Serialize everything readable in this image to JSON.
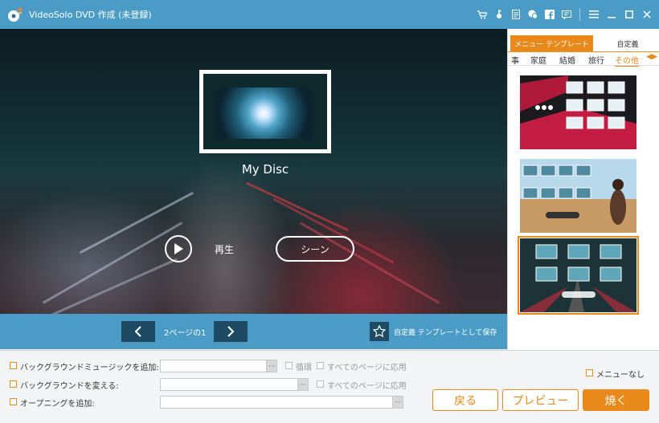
{
  "window": {
    "title": "VideoSolo DVD 作成 (未登録)"
  },
  "title_icons": [
    "cart-icon",
    "key-icon",
    "document-icon",
    "chat-icon",
    "facebook-icon",
    "feedback-icon",
    "menu-icon",
    "minimize-icon",
    "maximize-icon",
    "close-icon"
  ],
  "preview": {
    "disc_title": "My Disc",
    "play_label": "再生",
    "scene_label": "シーン"
  },
  "pagebar": {
    "page_info": "2ページの1",
    "save_template_label": "自定義 テンプレートとして保存"
  },
  "right_panel": {
    "tabs": {
      "menu_template": "メニュー テンプレート",
      "custom": "自定義"
    },
    "categories": [
      "事",
      "家庭",
      "結婚",
      "旅行",
      "その他"
    ],
    "active_category": "その他",
    "selected_template": 3
  },
  "bottom": {
    "bg_music_label": "バックグラウンドミュージックを追加:",
    "loop_label": "循環",
    "apply_all_label_1": "すべてのページに応用",
    "bg_change_label": "バックグラウンドを変える:",
    "apply_all_label_2": "すべてのページに応用",
    "opening_label": "オープニングを追加:",
    "dots": "···",
    "no_menu_label": "メニューなし",
    "back_button": "戻る",
    "preview_button": "プレビュー",
    "burn_button": "焼く"
  },
  "colors": {
    "accent": "#e8891a",
    "title_bar": "#4a9cc6",
    "nav_button": "#1e4a63"
  }
}
